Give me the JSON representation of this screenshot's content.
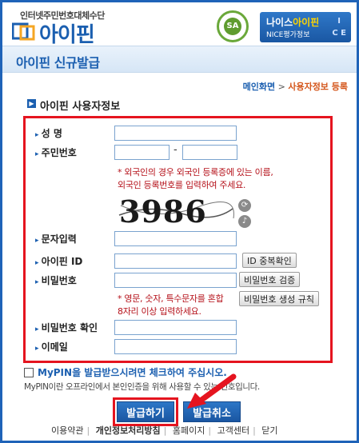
{
  "header": {
    "logo_sub": "인터넷주민번호대체수단",
    "logo_text": "아이핀",
    "seal_text": "SA",
    "nice_title_a": "나이스",
    "nice_title_b": "아이핀",
    "nice_sub": "NICE평가정보",
    "nice_badge_top": "I",
    "nice_badge_bottom": "C E"
  },
  "titlebar": {
    "title": "아이핀 신규발급"
  },
  "breadcrumb": {
    "home": "메인화면",
    "sep": " > ",
    "current": "사용자정보 등록"
  },
  "section": {
    "title": "아이핀 사용자정보"
  },
  "form": {
    "name_label": "성    명",
    "ssn_label": "주민번호",
    "ssn_dash": "-",
    "ssn_note_1": "* 외국인의 경우 외국인 등록증에 있는 이름,",
    "ssn_note_2": "외국인 등록번호를 입력하여 주세요.",
    "captcha_text": "3986",
    "captcha_label": "문자입력",
    "ipin_label": "아이핀 ID",
    "dup_check": "ID 중복확인",
    "pw_label": "비밀번호",
    "pw_check": "비밀번호 검증",
    "pw_note_1": "* 영문, 숫자, 특수문자를 혼합",
    "pw_note_2": "8자리 이상 입력하세요.",
    "pw_rule": "비밀번호 생성 규칙",
    "pw_confirm_label": "비밀번호 확인",
    "email_label": "이메일"
  },
  "mypin": {
    "label": "MyPIN을 발급받으시려면 체크하여 주십시오.",
    "note": "MyPIN이란 오프라인에서 본인인증을 위해 사용할 수 있는 번호입니다."
  },
  "buttons": {
    "issue": "발급하기",
    "cancel": "발급취소"
  },
  "footer": {
    "terms": "이용약관",
    "privacy": "개인정보처리방침",
    "homepage": "홈페이지",
    "support": "고객센터",
    "close": "닫기"
  },
  "colors": {
    "brand": "#1b5fb0",
    "highlight": "#e5141f",
    "note": "#b5111a"
  }
}
